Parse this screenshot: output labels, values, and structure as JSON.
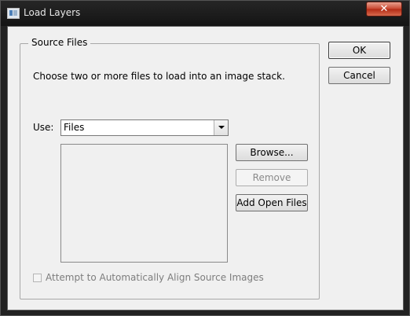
{
  "window": {
    "title": "Load Layers",
    "close_glyph": "✕"
  },
  "source_files": {
    "legend": "Source Files",
    "description": "Choose two or more files to load into an image stack.",
    "use_label": "Use:",
    "use_selected": "Files",
    "buttons": {
      "browse": "Browse...",
      "remove": "Remove",
      "add_open_files": "Add Open Files"
    },
    "file_list": [],
    "align_checkbox": {
      "label": "Attempt to Automatically Align Source Images",
      "checked": false,
      "enabled": false
    }
  },
  "dialog_buttons": {
    "ok": "OK",
    "cancel": "Cancel"
  }
}
